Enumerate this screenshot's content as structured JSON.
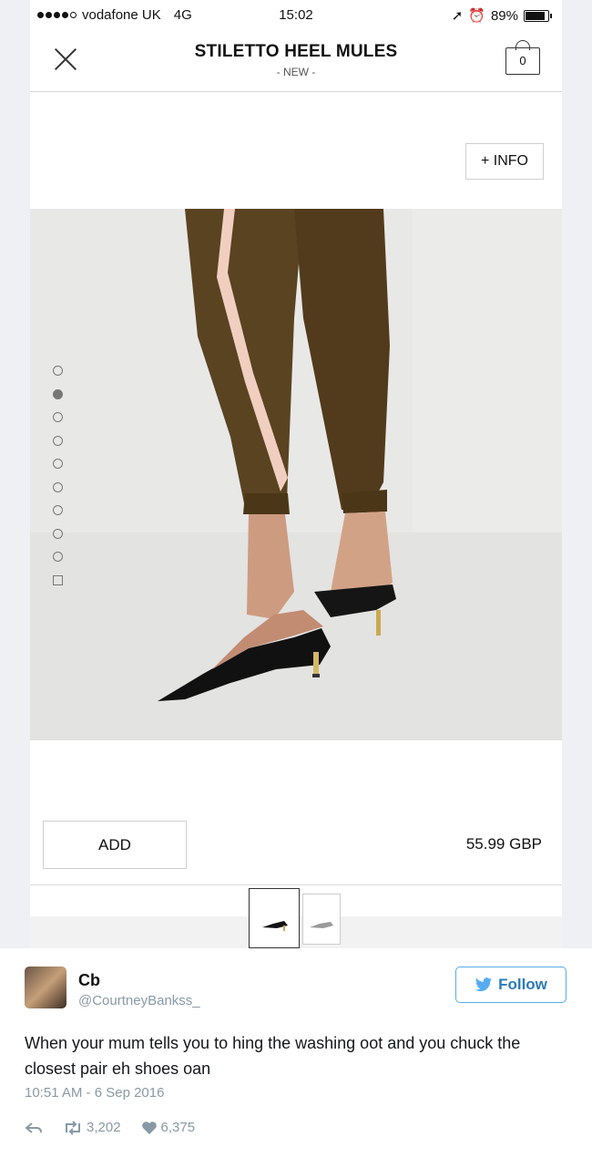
{
  "status_bar": {
    "carrier": "vodafone UK",
    "network": "4G",
    "time": "15:02",
    "battery": "89%"
  },
  "nav": {
    "title": "STILETTO HEEL MULES",
    "subtitle": "- NEW -",
    "bag_count": "0"
  },
  "product": {
    "info_label": "+ INFO",
    "add_label": "ADD",
    "price": "55.99 GBP",
    "gallery_dots": 10,
    "active_dot": 2
  },
  "tweet": {
    "name": "Cb",
    "handle": "@CourtneyBankss_",
    "follow_label": "Follow",
    "text": "When your mum tells you to hing the washing oot and you chuck the closest pair eh shoes oan",
    "timestamp": "10:51 AM - 6 Sep 2016",
    "retweets": "3,202",
    "likes": "6,375"
  },
  "colors": {
    "twitter_blue": "#55acee",
    "trouser_brown": "#5a4321",
    "stripe_pink": "#f1cfc0",
    "shoe_black": "#111111"
  }
}
